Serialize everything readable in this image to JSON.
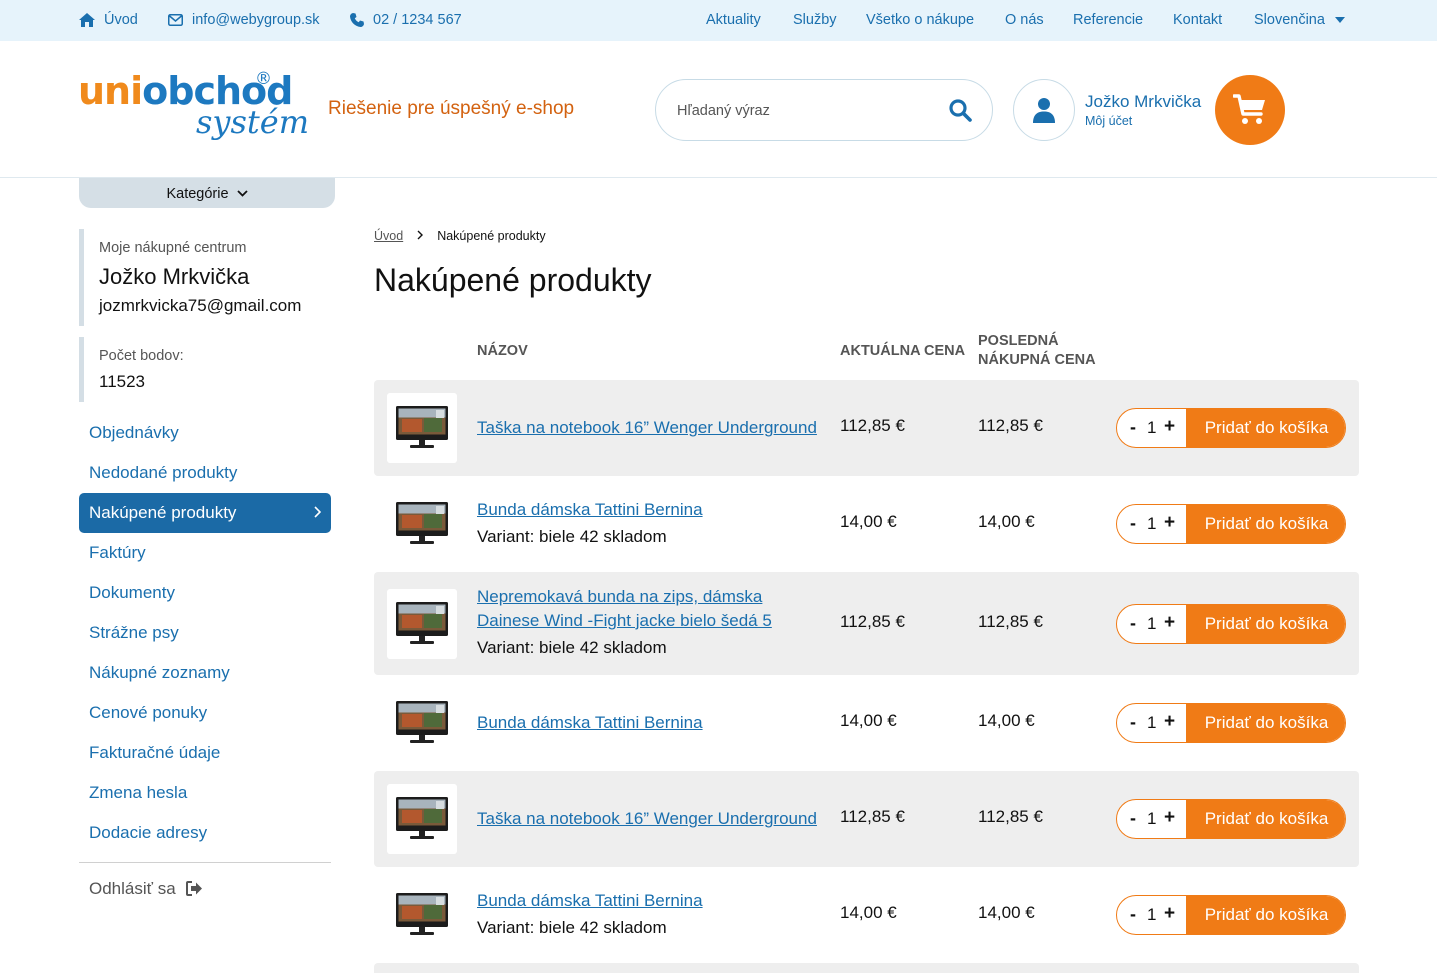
{
  "topbar": {
    "home": "Úvod",
    "email": "info@webygroup.sk",
    "phone": "02 / 1234 567",
    "nav": [
      "Aktuality",
      "Služby",
      "Všetko o nákupe",
      "O nás",
      "Referencie",
      "Kontakt"
    ],
    "language": "Slovenčina"
  },
  "header": {
    "logo_top_a": "uni",
    "logo_top_b": "obchod",
    "logo_reg": "®",
    "logo_bottom": "systém",
    "tagline": "Riešenie pre úspešný e-shop",
    "search_placeholder": "Hľadaný výraz",
    "account_name": "Jožko Mrkvička",
    "account_sub": "Môj účet"
  },
  "sidebar": {
    "categories": "Kategórie",
    "center_label": "Moje nákupné centrum",
    "user_name": "Jožko Mrkvička",
    "user_email": "jozmrkvicka75@gmail.com",
    "points_label": "Počet bodov:",
    "points_value": "11523",
    "menu": [
      "Objednávky",
      "Nedodané produkty",
      "Nakúpené produkty",
      "Faktúry",
      "Dokumenty",
      "Strážne psy",
      "Nákupné zoznamy",
      "Cenové ponuky",
      "Fakturačné údaje",
      "Zmena hesla",
      "Dodacie adresy"
    ],
    "logout": "Odhlásiť sa"
  },
  "main": {
    "breadcrumb_home": "Úvod",
    "breadcrumb_current": "Nakúpené produkty",
    "title": "Nakúpené produkty",
    "columns": {
      "name": "Názov",
      "current_price": "Aktuálna cena",
      "last_price_1": "Posledná",
      "last_price_2": "nákupná cena"
    },
    "add_label": "Pridať do košíka",
    "products": [
      {
        "name": "Taška na notebook 16” Wenger Underground",
        "variant": "",
        "current": "112,85 €",
        "last": "112,85 €",
        "qty": "1"
      },
      {
        "name": "Bunda dámska Tattini Bernina",
        "variant": "Variant: biele 42 skladom",
        "current": "14,00 €",
        "last": "14,00 €",
        "qty": "1"
      },
      {
        "name": "Nepremokavá bunda na zips, dámska Dainese Wind -Fight jacke bielo šedá 5",
        "variant": "Variant: biele 42 skladom",
        "current": "112,85 €",
        "last": "112,85 €",
        "qty": "1"
      },
      {
        "name": "Bunda dámska Tattini Bernina",
        "variant": "",
        "current": "14,00 €",
        "last": "14,00 €",
        "qty": "1"
      },
      {
        "name": "Taška na notebook 16” Wenger Underground",
        "variant": "",
        "current": "112,85 €",
        "last": "112,85 €",
        "qty": "1"
      },
      {
        "name": "Bunda dámska Tattini Bernina",
        "variant": "Variant: biele 42 skladom",
        "current": "14,00 €",
        "last": "14,00 €",
        "qty": "1"
      }
    ]
  },
  "colors": {
    "brand_blue": "#1a6fae",
    "brand_orange": "#f07b16",
    "topbar_bg": "#e6f3fb"
  }
}
